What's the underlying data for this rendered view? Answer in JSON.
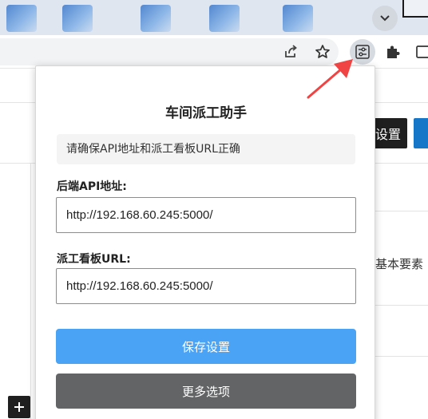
{
  "popup": {
    "title": "车间派工助手",
    "notice": "请确保API地址和派工看板URL正确",
    "api_label": "后端API地址:",
    "api_value": "http://192.168.60.245:5000/",
    "board_label": "派工看板URL:",
    "board_value": "http://192.168.60.245:5000/",
    "save_label": "保存设置",
    "more_label": "更多选项"
  },
  "background": {
    "dark_button_fragment": "设置",
    "side_text_fragment": "基本要素"
  },
  "icons": {
    "toolbar": [
      "share-icon",
      "star-icon",
      "extension-sliders-icon",
      "puzzle-icon",
      "side-panel-icon"
    ],
    "tabs": [
      "chevron-down-icon"
    ]
  },
  "colors": {
    "save_button": "#4aa3f5",
    "more_button": "#636466",
    "arrow": "#f04444"
  }
}
